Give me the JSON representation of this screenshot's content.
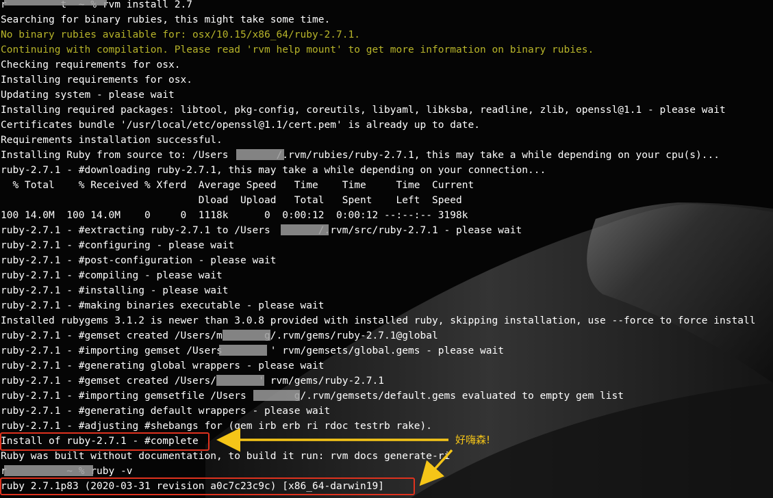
{
  "terminal": {
    "lines": [
      {
        "text": "r         t  ~ % rvm install 2.7",
        "kind": "prompt"
      },
      {
        "text": "Searching for binary rubies, this might take some time.",
        "kind": "normal"
      },
      {
        "text": "No binary rubies available for: osx/10.15/x86_64/ruby-2.7.1.",
        "kind": "warn"
      },
      {
        "text": "Continuing with compilation. Please read 'rvm help mount' to get more information on binary rubies.",
        "kind": "warn"
      },
      {
        "text": "Checking requirements for osx.",
        "kind": "normal"
      },
      {
        "text": "Installing requirements for osx.",
        "kind": "normal"
      },
      {
        "text": "Updating system - please wait",
        "kind": "normal"
      },
      {
        "text": "Installing required packages: libtool, pkg-config, coreutils, libyaml, libksba, readline, zlib, openssl@1.1 - please wait",
        "kind": "normal"
      },
      {
        "text": "Certificates bundle '/usr/local/etc/openssl@1.1/cert.pem' is already up to date.",
        "kind": "normal"
      },
      {
        "text": "Requirements installation successful.",
        "kind": "normal"
      },
      {
        "text": "Installing Ruby from source to: /Users        /.rvm/rubies/ruby-2.7.1, this may take a while depending on your cpu(s)...",
        "kind": "normal"
      },
      {
        "text": "ruby-2.7.1 - #downloading ruby-2.7.1, this may take a while depending on your connection...",
        "kind": "normal"
      },
      {
        "text": "  % Total    % Received % Xferd  Average Speed   Time    Time     Time  Current",
        "kind": "normal"
      },
      {
        "text": "                                 Dload  Upload   Total   Spent    Left  Speed",
        "kind": "normal"
      },
      {
        "text": "100 14.0M  100 14.0M    0     0  1118k      0  0:00:12  0:00:12 --:--:-- 3198k",
        "kind": "normal"
      },
      {
        "text": "ruby-2.7.1 - #extracting ruby-2.7.1 to /Users        /.rvm/src/ruby-2.7.1 - please wait",
        "kind": "normal"
      },
      {
        "text": "ruby-2.7.1 - #configuring - please wait",
        "kind": "normal"
      },
      {
        "text": "ruby-2.7.1 - #post-configuration - please wait",
        "kind": "normal"
      },
      {
        "text": "ruby-2.7.1 - #compiling - please wait",
        "kind": "normal"
      },
      {
        "text": "ruby-2.7.1 - #installing - please wait",
        "kind": "normal"
      },
      {
        "text": "ruby-2.7.1 - #making binaries executable - please wait",
        "kind": "normal"
      },
      {
        "text": "Installed rubygems 3.1.2 is newer than 3.0.8 provided with installed ruby, skipping installation, use --force to force install",
        "kind": "normal"
      },
      {
        "text": "ruby-2.7.1 - #gemset created /Users/m       g/.rvm/gems/ruby-2.7.1@global",
        "kind": "normal"
      },
      {
        "text": "ruby-2.7.1 - #importing gemset /Users        ' rvm/gemsets/global.gems - please wait",
        "kind": "normal"
      },
      {
        "text": "ruby-2.7.1 - #generating global wrappers - please wait",
        "kind": "normal"
      },
      {
        "text": "ruby-2.7.1 - #gemset created /Users/       ' rvm/gems/ruby-2.7.1",
        "kind": "normal"
      },
      {
        "text": "ruby-2.7.1 - #importing gemsetfile /Users        g/.rvm/gemsets/default.gems evaluated to empty gem list",
        "kind": "normal"
      },
      {
        "text": "ruby-2.7.1 - #generating default wrappers - please wait",
        "kind": "normal"
      },
      {
        "text": "ruby-2.7.1 - #adjusting #shebangs for (gem irb erb ri rdoc testrb rake).",
        "kind": "normal"
      },
      {
        "text": "Install of ruby-2.7.1 - #complete",
        "kind": "normal"
      },
      {
        "text": "Ruby was built without documentation, to build it run: rvm docs generate-ri",
        "kind": "normal"
      },
      {
        "text": "r          ~ % ruby -v",
        "kind": "prompt"
      },
      {
        "text": "ruby 2.7.1p83 (2020-03-31 revision a0c7c23c9c) [x86_64-darwin19]",
        "kind": "normal"
      }
    ]
  },
  "annotation": {
    "text": "好嗨森!",
    "color": "#f5c518"
  },
  "colors": {
    "text": "#ffffff",
    "warning": "#b8b52a",
    "highlight_box": "#e0321e",
    "arrow": "#f5c518"
  }
}
